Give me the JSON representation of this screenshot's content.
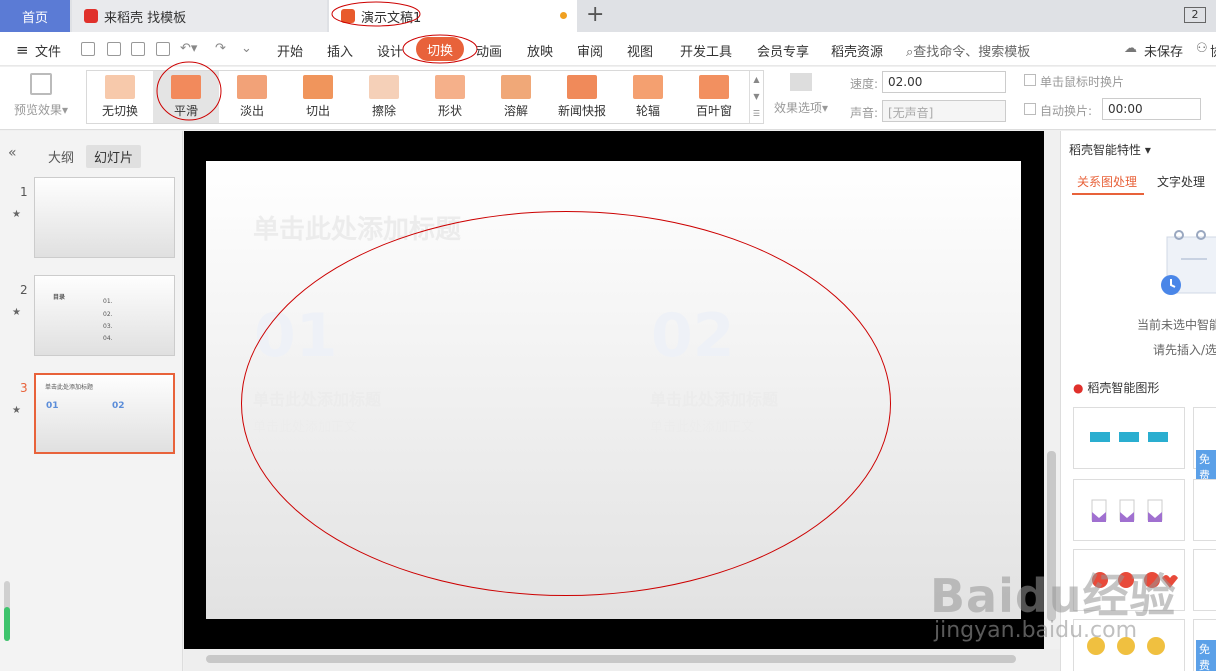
{
  "tabs": {
    "home": "首页",
    "tab1": "来稻壳 找模板",
    "tab2": "演示文稿1",
    "window_btn": "2"
  },
  "menu": {
    "file": "文件",
    "items": [
      "开始",
      "插入",
      "设计",
      "切换",
      "动画",
      "放映",
      "审阅",
      "视图",
      "开发工具",
      "会员专享",
      "稻壳资源"
    ],
    "active": "切换",
    "search": "查找命令、搜索模板",
    "unsaved": "未保存",
    "collab": "协"
  },
  "ribbon": {
    "preview": "预览效果",
    "transitions": [
      {
        "label": "无切换",
        "color": "#f7c9ab"
      },
      {
        "label": "平滑",
        "color": "#f28a5c"
      },
      {
        "label": "淡出",
        "color": "#f2a278"
      },
      {
        "label": "切出",
        "color": "#f0955c"
      },
      {
        "label": "擦除",
        "color": "#f5d0b8"
      },
      {
        "label": "形状",
        "color": "#f5b08a"
      },
      {
        "label": "溶解",
        "color": "#f0a878"
      },
      {
        "label": "新闻快报",
        "color": "#f08a5a"
      },
      {
        "label": "轮辐",
        "color": "#f4a070"
      },
      {
        "label": "百叶窗",
        "color": "#f29060"
      }
    ],
    "active_transition": "平滑",
    "effect_options": "效果选项",
    "speed_label": "速度:",
    "speed_value": "02.00",
    "sound_label": "声音:",
    "sound_value": "[无声音]",
    "on_click_label": "单击鼠标时换片",
    "auto_label": "自动换片:",
    "auto_value": "00:00"
  },
  "left_panel": {
    "tab_outline": "大纲",
    "tab_slides": "幻灯片",
    "slides": [
      {
        "num": "1"
      },
      {
        "num": "2",
        "title": "目录",
        "items": [
          "01.",
          "02.",
          "03.",
          "04."
        ]
      },
      {
        "num": "3",
        "title": "单击此处添加标题",
        "n1": "01",
        "n2": "02"
      }
    ],
    "active_slide": "3"
  },
  "slide": {
    "title": "单击此处添加标题",
    "num1": "01",
    "num2": "02",
    "subtitle1": "单击此处添加标题",
    "subtitle2": "单击此处添加标题",
    "body1": "单击此处添加正文",
    "body2": "单击此处添加正文"
  },
  "right_panel": {
    "header": "稻壳智能特性",
    "tab1": "关系图处理",
    "tab2": "文字处理",
    "msg1": "当前未选中智能",
    "msg2": "请先插入/选",
    "section": "稻壳智能图形",
    "free": "免费",
    "free2": "免费"
  },
  "watermark": {
    "big": "Baidu经验",
    "small": "jingyan.baidu.com"
  }
}
